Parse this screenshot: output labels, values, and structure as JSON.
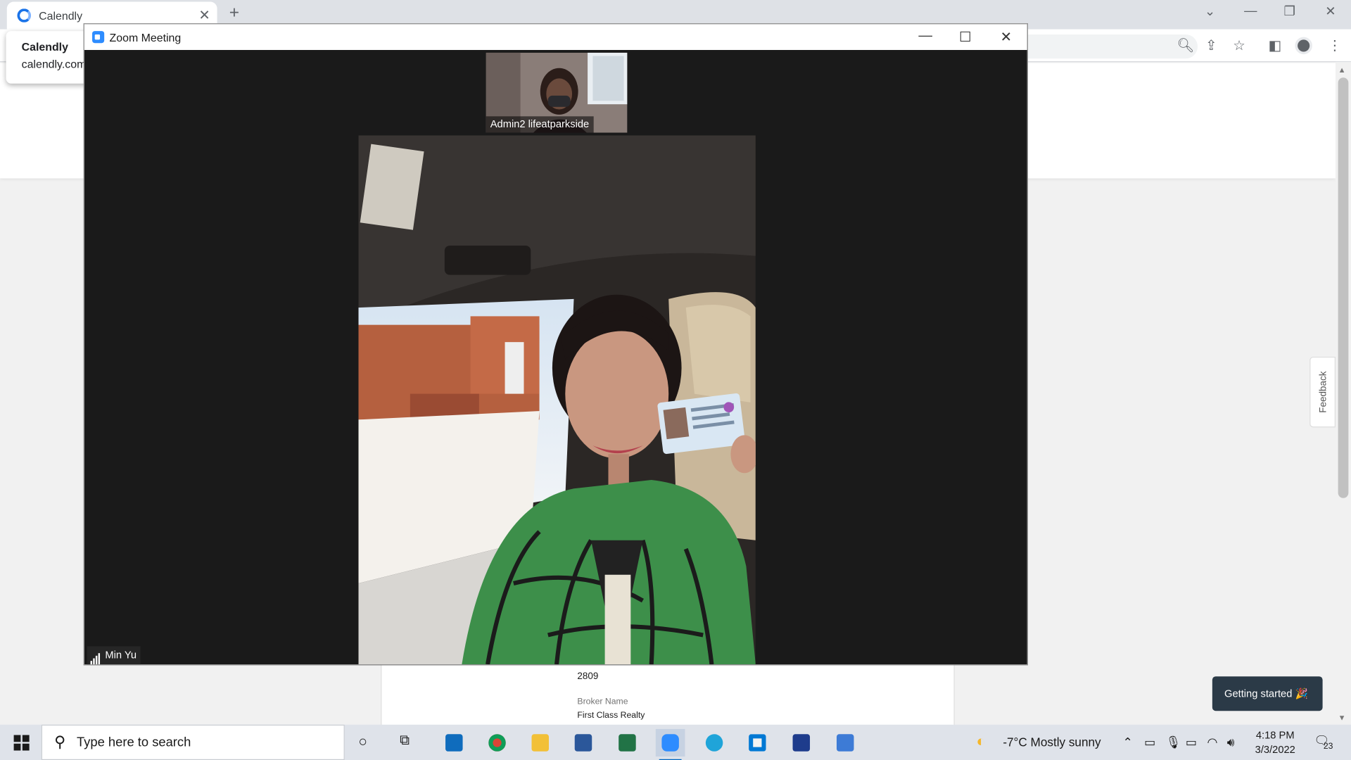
{
  "browser": {
    "tab": {
      "title": "Calendly"
    },
    "tooltip": {
      "title": "Calendly",
      "url": "calendly.com"
    }
  },
  "page": {
    "card": {
      "number": "2809",
      "broker_label": "Broker Name",
      "broker_value": "First Class Realty"
    },
    "getting_started": "Getting started 🎉",
    "feedback": "Feedback"
  },
  "zoom": {
    "title": "Zoom Meeting",
    "thumbnail_name": "Admin2 lifeatparkside",
    "active_speaker": "Min Yu"
  },
  "taskbar": {
    "search_placeholder": "Type here to search",
    "weather": "-7°C  Mostly sunny",
    "time": "4:18 PM",
    "date": "3/3/2022",
    "notifications": "23"
  }
}
